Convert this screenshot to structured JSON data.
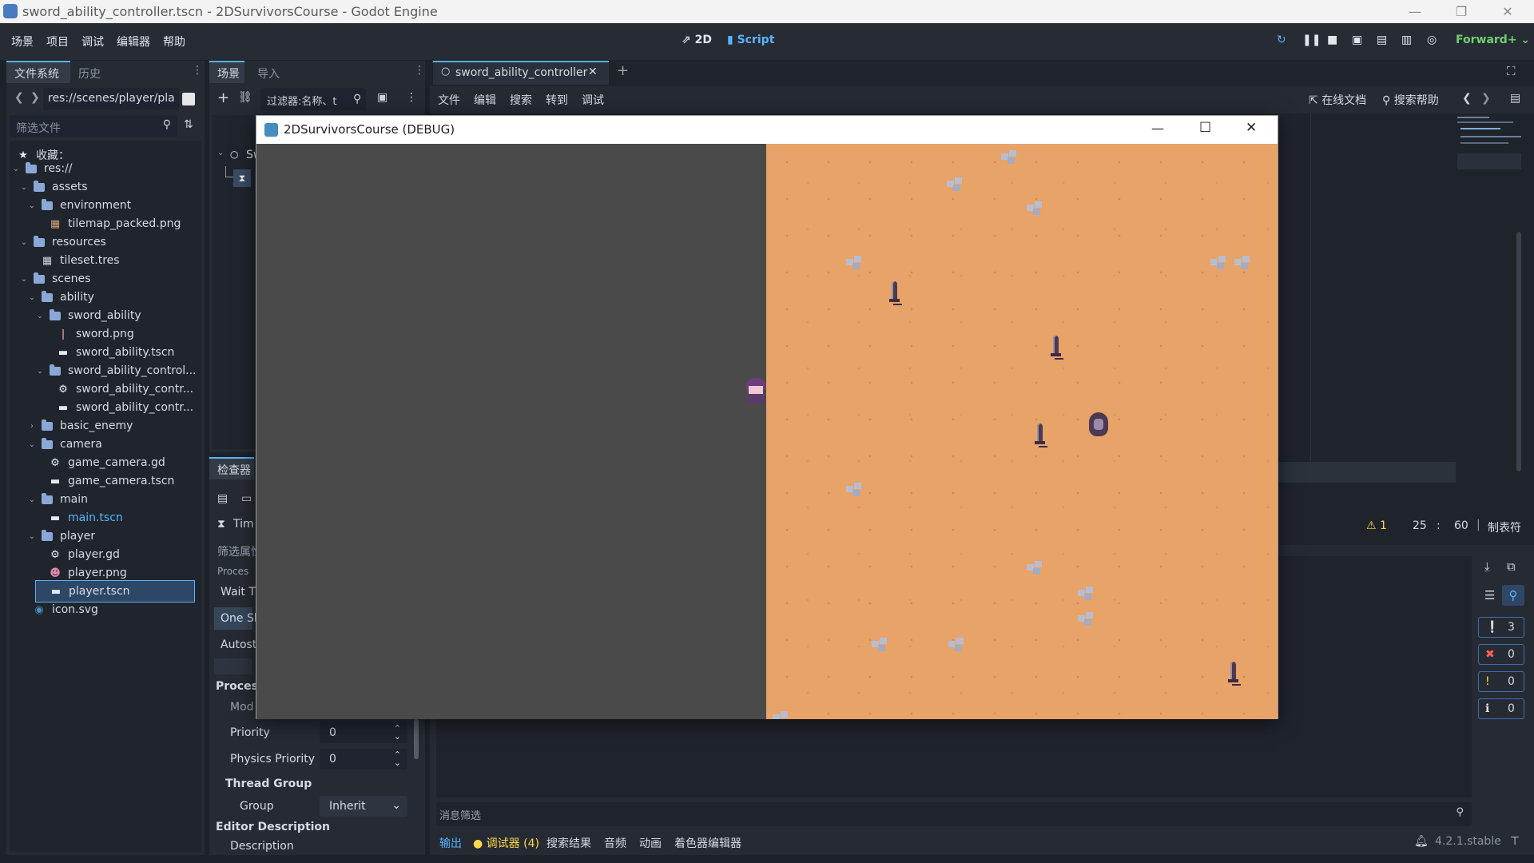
{
  "window": {
    "title": "sword_ability_controller.tscn - 2DSurvivorsCourse - Godot Engine",
    "controls": [
      "—",
      "❐",
      "✕"
    ]
  },
  "menubar": {
    "items": [
      "场景",
      "项目",
      "调试",
      "编辑器",
      "帮助"
    ],
    "center": {
      "mode_2d": "2D",
      "mode_script": "Script"
    },
    "renderer": "Forward+"
  },
  "filesystem": {
    "tabs": [
      "文件系统",
      "历史"
    ],
    "path": "res://scenes/player/pla",
    "filter_placeholder": "筛选文件",
    "favorites_label": "收藏：",
    "tree": [
      {
        "label": "res://",
        "icon": "folder-icon",
        "level": 0,
        "arrow": "⌄"
      },
      {
        "label": "assets",
        "icon": "folder-icon",
        "level": 1,
        "arrow": "⌄"
      },
      {
        "label": "environment",
        "icon": "folder-icon",
        "level": 2,
        "arrow": "⌄"
      },
      {
        "label": "tilemap_packed.png",
        "icon": "image-icon",
        "level": 3,
        "arrow": ""
      },
      {
        "label": "resources",
        "icon": "folder-icon",
        "level": 1,
        "arrow": "⌄"
      },
      {
        "label": "tileset.tres",
        "icon": "tileset-icon",
        "level": 2,
        "arrow": ""
      },
      {
        "label": "scenes",
        "icon": "folder-icon",
        "level": 1,
        "arrow": "⌄"
      },
      {
        "label": "ability",
        "icon": "folder-icon",
        "level": 2,
        "arrow": "⌄"
      },
      {
        "label": "sword_ability",
        "icon": "folder-icon",
        "level": 3,
        "arrow": "⌄"
      },
      {
        "label": "sword.png",
        "icon": "sword-image-icon",
        "level": 4,
        "arrow": ""
      },
      {
        "label": "sword_ability.tscn",
        "icon": "scene-icon",
        "level": 4,
        "arrow": ""
      },
      {
        "label": "sword_ability_control...",
        "icon": "folder-icon",
        "level": 3,
        "arrow": "⌄"
      },
      {
        "label": "sword_ability_contr...",
        "icon": "gear-icon",
        "level": 4,
        "arrow": ""
      },
      {
        "label": "sword_ability_contr...",
        "icon": "scene-icon",
        "level": 4,
        "arrow": ""
      },
      {
        "label": "basic_enemy",
        "icon": "folder-icon",
        "level": 2,
        "arrow": "›"
      },
      {
        "label": "camera",
        "icon": "folder-icon",
        "level": 2,
        "arrow": "⌄"
      },
      {
        "label": "game_camera.gd",
        "icon": "gear-icon",
        "level": 3,
        "arrow": ""
      },
      {
        "label": "game_camera.tscn",
        "icon": "scene-icon",
        "level": 3,
        "arrow": ""
      },
      {
        "label": "main",
        "icon": "folder-icon",
        "level": 2,
        "arrow": "⌄"
      },
      {
        "label": "main.tscn",
        "icon": "scene-icon",
        "level": 3,
        "arrow": "",
        "accent": true
      },
      {
        "label": "player",
        "icon": "folder-icon",
        "level": 2,
        "arrow": "⌄"
      },
      {
        "label": "player.gd",
        "icon": "gear-icon",
        "level": 3,
        "arrow": ""
      },
      {
        "label": "player.png",
        "icon": "player-image-icon",
        "level": 3,
        "arrow": ""
      },
      {
        "label": "player.tscn",
        "icon": "scene-icon",
        "level": 3,
        "arrow": "",
        "selected": true
      },
      {
        "label": "icon.svg",
        "icon": "godot-icon",
        "level": 1,
        "arrow": ""
      }
    ]
  },
  "scene_dock": {
    "tabs": [
      "场景",
      "导入"
    ],
    "filter_placeholder": "过滤器:名称、t",
    "root_node": "Sw"
  },
  "inspector": {
    "tab": "检查器",
    "node_label": "Tim",
    "filter_label": "筛选属性",
    "rows": {
      "proc": "Proces",
      "wait_time": "Wait T",
      "one_shot": "One Sh",
      "autostart": "Autost",
      "process_section": "Process",
      "mode": "Mod",
      "priority": "Priority",
      "priority_value": "0",
      "physics_priority": "Physics Priority",
      "physics_priority_value": "0",
      "thread_group": "Thread Group",
      "group": "Group",
      "group_value": "Inherit",
      "editor_description": "Editor Description",
      "description": "Description"
    }
  },
  "editor": {
    "tab": "sword_ability_controller",
    "menu": [
      "文件",
      "编辑",
      "搜索",
      "转到",
      "调试"
    ],
    "online_docs": "在线文档",
    "search_help": "搜索帮助",
    "status": {
      "warnings": "1",
      "line": "25",
      "sep": ":",
      "col": "60",
      "indent": "制表符"
    }
  },
  "game_window": {
    "title": "2DSurvivorsCourse (DEBUG)",
    "controls": [
      "—",
      "☐",
      "✕"
    ]
  },
  "bottom_panel": {
    "filter_label": "消息筛选",
    "tabs": [
      "输出",
      "调试器 (4)",
      "搜索结果",
      "音频",
      "动画",
      "着色器编辑器"
    ],
    "version": "4.2.1.stable",
    "counters": [
      {
        "value": "3",
        "icon": "message-icon",
        "color": "#e6e9ee"
      },
      {
        "value": "0",
        "icon": "error-icon",
        "color": "#ff5d5d"
      },
      {
        "value": "0",
        "icon": "warning-icon",
        "color": "#ffd84a"
      },
      {
        "value": "0",
        "icon": "info-icon",
        "color": "#e6e9ee"
      }
    ]
  },
  "colors": {
    "accent": "#57b3ff",
    "sand": "#e8a369",
    "void": "#4a4a4a",
    "warning": "#ffd84a"
  }
}
